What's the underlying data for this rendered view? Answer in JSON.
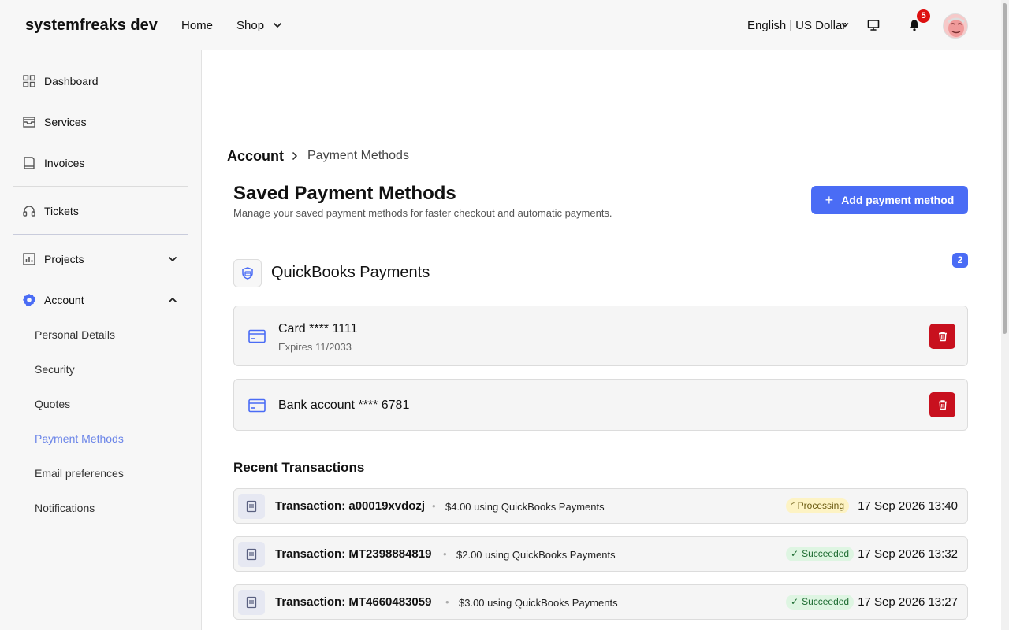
{
  "header": {
    "brand": "systemfreaks dev",
    "nav": {
      "home": "Home",
      "shop": "Shop"
    },
    "locale": {
      "language": "English",
      "separator": "|",
      "currency": "US Dollar"
    },
    "notification_count": "5"
  },
  "sidebar": {
    "dashboard": "Dashboard",
    "services": "Services",
    "invoices": "Invoices",
    "tickets": "Tickets",
    "projects": "Projects",
    "account": "Account",
    "account_items": [
      "Personal Details",
      "Security",
      "Quotes",
      "Payment Methods",
      "Email preferences",
      "Notifications"
    ],
    "active_item": "Payment Methods",
    "accent_color": "#6a84e8"
  },
  "breadcrumb": {
    "parent": "Account",
    "current": "Payment Methods"
  },
  "page": {
    "title": "Saved Payment Methods",
    "subtitle": "Manage your saved payment methods for faster checkout and automatic payments.",
    "add_button": "Add payment method",
    "primary_color": "#4a6cf5"
  },
  "gateway": {
    "name": "QuickBooks Payments",
    "count": "2",
    "methods": [
      {
        "title": "Card **** 1111",
        "subtitle": "Expires 11/2033"
      },
      {
        "title": "Bank account **** 6781",
        "subtitle": ""
      }
    ]
  },
  "transactions": {
    "title": "Recent Transactions",
    "items": [
      {
        "title": "Transaction: a00019xvdozj",
        "detail": "$4.00 using QuickBooks Payments",
        "status": "Processing",
        "date": "17 Sep 2026 13:40"
      },
      {
        "title": "Transaction: MT2398884819",
        "detail": "$2.00 using QuickBooks Payments",
        "status": "Succeeded",
        "date": "17 Sep 2026 13:32"
      },
      {
        "title": "Transaction: MT4660483059",
        "detail": "$3.00 using QuickBooks Payments",
        "status": "Succeeded",
        "date": "17 Sep 2026 13:27"
      }
    ]
  }
}
